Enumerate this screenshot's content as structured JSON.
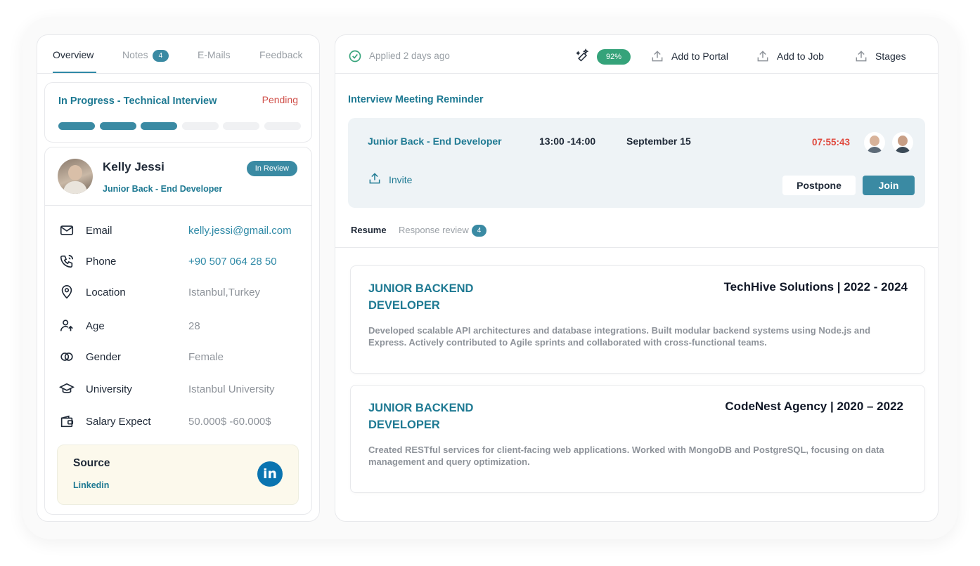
{
  "tabs": {
    "overview": "Overview",
    "notes": "Notes",
    "notes_count": "4",
    "emails": "E-Mails",
    "feedback": "Feedback"
  },
  "progress": {
    "title": "In Progress - Technical Interview",
    "status": "Pending",
    "completed_steps": 3,
    "total_steps": 6
  },
  "candidate": {
    "name": "Kelly Jessi",
    "role": "Junior Back - End Developer",
    "badge": "In Review"
  },
  "info": [
    {
      "icon": "mail-icon",
      "label": "Email",
      "value": "kelly.jessi@gmail.com"
    },
    {
      "icon": "phone-icon",
      "label": "Phone",
      "value": "+90 507 064 28 50"
    },
    {
      "icon": "location-icon",
      "label": "Location",
      "value": "Istanbul,Turkey"
    },
    {
      "icon": "age-icon",
      "label": "Age",
      "value": "28"
    },
    {
      "icon": "gender-icon",
      "label": "Gender",
      "value": "Female"
    },
    {
      "icon": "graduation-cap-icon",
      "label": "University",
      "value": "Istanbul University"
    },
    {
      "icon": "wallet-icon",
      "label": "Salary Expect",
      "value": "50.000$ -60.000$"
    }
  ],
  "source": {
    "title": "Source",
    "value": "Linkedin",
    "icon_text": "in"
  },
  "topbar": {
    "applied": "Applied 2 days ago",
    "match": "92%",
    "add_to_portal": "Add to Portal",
    "add_to_job": "Add to Job",
    "stages": "Stages"
  },
  "meeting": {
    "section_title": "Interview Meeting Reminder",
    "role": "Junior Back - End Developer",
    "time": "13:00 -14:00",
    "date": "September 15",
    "countdown": "07:55:43",
    "invite": "Invite",
    "postpone": "Postpone",
    "join": "Join"
  },
  "resume_tabs": {
    "resume": "Resume",
    "response_review": "Response review",
    "response_count": "4"
  },
  "experience": [
    {
      "title": "JUNIOR BACKEND DEVELOPER",
      "company": "TechHive Solutions | 2022 - 2024",
      "description": "Developed scalable API architectures and database integrations. Built modular backend systems using Node.js and Express. Actively contributed to Agile sprints and collaborated with cross-functional teams."
    },
    {
      "title": "JUNIOR BACKEND DEVELOPER",
      "company": "CodeNest Agency | 2020 – 2022",
      "description": "Created RESTful services for client-facing web applications. Worked with MongoDB and PostgreSQL, focusing on data management and query optimization."
    }
  ],
  "colors": {
    "accent": "#3a8aa3",
    "accent_text": "#1f7a93",
    "danger": "#e04a3f",
    "success": "#35a37a",
    "source_bg": "#fcf9ec",
    "linkedin": "#0a74b0"
  }
}
